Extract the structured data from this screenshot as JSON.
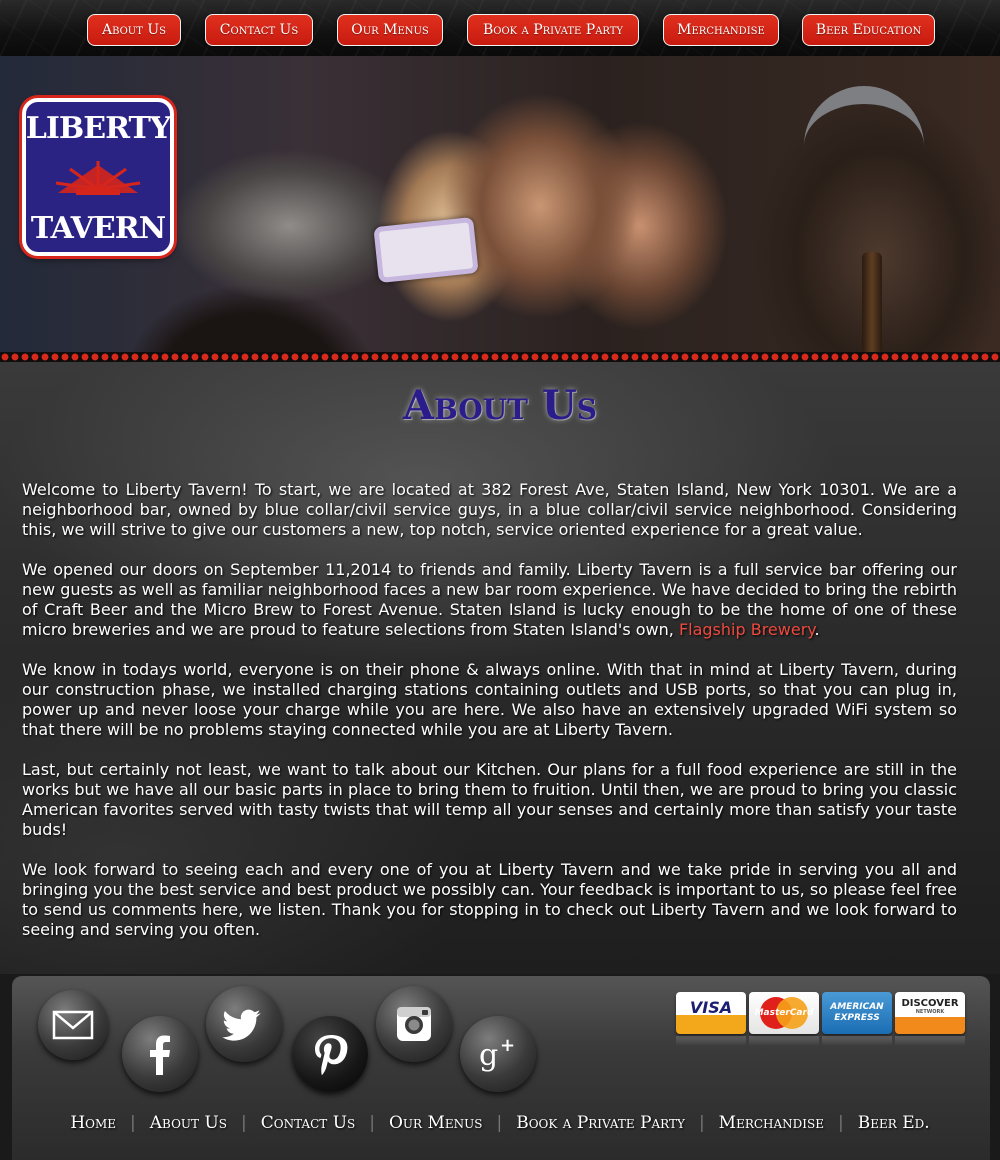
{
  "top_nav": [
    {
      "label": "About Us"
    },
    {
      "label": "Contact Us"
    },
    {
      "label": "Our Menus"
    },
    {
      "label": "Book a Private Party"
    },
    {
      "label": "Merchandise"
    },
    {
      "label": "Beer Education"
    }
  ],
  "logo": {
    "line1": "LIBERTY",
    "line2": "TAVERN"
  },
  "main": {
    "title": "About Us",
    "p1": "Welcome to Liberty Tavern! To start, we are located at 382 Forest Ave, Staten Island, New York 10301. We are a neighborhood bar, owned by blue collar/civil service guys, in a blue collar/civil service neighborhood. Considering this, we will strive to give our customers a new, top notch, service oriented experience for a great value.",
    "p2": "We opened our doors on September 11,2014 to friends and family. Liberty Tavern is a full service bar offering our new guests as well as familiar neighborhood faces a new bar room experience. We have decided to bring the rebirth of Craft Beer and the Micro Brew to Forest Avenue. Staten Island is lucky enough to be the home of one of these micro breweries and we are proud to feature selections from Staten Island's own, ",
    "p2_link": "Flagship Brewery",
    "p2_end": ".",
    "p3": "We know in todays world, everyone is on their phone & always online. With that in mind at Liberty Tavern, during our construction phase, we installed charging stations containing outlets and USB ports, so that you can plug in, power up and never loose your charge while you are here. We also have an extensively upgraded WiFi system so that there will be no problems staying connected while you are at Liberty Tavern.",
    "p4": "Last, but certainly not least, we want to talk about our Kitchen. Our plans for a full food experience are still in the works but we have all our basic parts in place to bring them to fruition. Until then, we are proud to bring you classic American favorites served with tasty twists that will temp all your senses and certainly more than satisfy your taste buds!",
    "p5": "We look forward to seeing each and every one of you at Liberty Tavern and we take pride in serving you all and bringing you the best service and best product we possibly can. Your feedback is important to us, so please feel free to send us comments here, we listen. Thank you for stopping in to check out Liberty Tavern and we look forward to seeing and serving you often."
  },
  "social_icons": [
    "email-icon",
    "facebook-icon",
    "twitter-icon",
    "pinterest-icon",
    "instagram-icon",
    "google-plus-icon"
  ],
  "cards": {
    "visa": "VISA",
    "mastercard": "MasterCard",
    "amex_1": "AMERICAN",
    "amex_2": "EXPRESS",
    "discover": "DISCOVER",
    "discover_sub": "NETWORK"
  },
  "footer_nav": [
    {
      "label": "Home"
    },
    {
      "label": "About Us"
    },
    {
      "label": "Contact Us"
    },
    {
      "label": "Our Menus"
    },
    {
      "label": "Book a Private Party"
    },
    {
      "label": "Merchandise"
    },
    {
      "label": "Beer Ed."
    }
  ],
  "footer_sep": "|",
  "colors": {
    "accent_red": "#d6251b",
    "title_purple": "#2a1c8a",
    "link_red": "#ee4a3f"
  }
}
